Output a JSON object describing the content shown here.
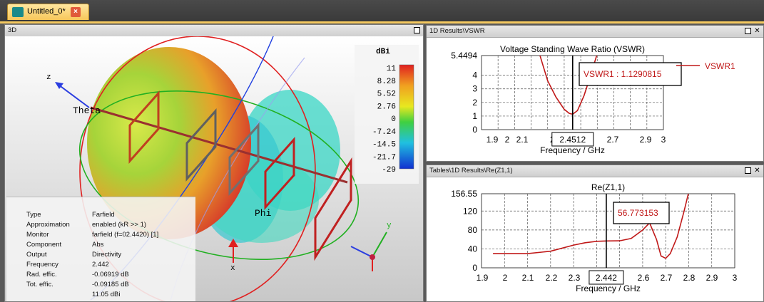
{
  "document_tab": {
    "label": "Untitled_0*",
    "close": "×"
  },
  "panel_3d": {
    "title": "3D",
    "axis_z": "z",
    "axis_theta": "Theta",
    "axis_phi": "Phi",
    "axis_x": "x",
    "axis_y": "y",
    "colorbar": {
      "unit": "dBi",
      "ticks": [
        "11",
        "8.28",
        "5.52",
        "2.76",
        "0",
        "-7.24",
        "-14.5",
        "-21.7",
        "-29"
      ]
    },
    "info": [
      {
        "key": "Type",
        "value": "Farfield"
      },
      {
        "key": "Approximation",
        "value": "enabled (kR >> 1)"
      },
      {
        "key": "Monitor",
        "value": "farfield (f=02.4420) [1]"
      },
      {
        "key": "Component",
        "value": "Abs"
      },
      {
        "key": "Output",
        "value": "Directivity"
      },
      {
        "key": "Frequency",
        "value": "2.442"
      },
      {
        "key": "Rad. effic.",
        "value": "-0.06919 dB"
      },
      {
        "key": "Tot. effic.",
        "value": "-0.09185 dB"
      },
      {
        "key": "",
        "value": "11.05 dBi"
      }
    ]
  },
  "panel_vswr": {
    "title": "1D Results\\VSWR",
    "chart_data": {
      "type": "line",
      "title": "Voltage Standing Wave Ratio (VSWR)",
      "xlabel": "Frequency / GHz",
      "ylabel": "",
      "xlim": [
        1.9,
        3
      ],
      "ylim": [
        0,
        5.4494
      ],
      "x_ticks": [
        "1.9",
        "2",
        "2.1",
        "2.",
        "2.7",
        "2.9",
        "3"
      ],
      "y_ticks": [
        "5.4494",
        "4",
        "3",
        "2",
        "1",
        "0"
      ],
      "marker_x": "2.4512",
      "marker_label": "VSWR1 : 1.1290815",
      "series": [
        {
          "name": "VSWR1",
          "x": [
            2.25,
            2.3,
            2.35,
            2.4,
            2.43,
            2.4512,
            2.48,
            2.52,
            2.56,
            2.6
          ],
          "y": [
            5.6,
            3.6,
            2.4,
            1.5,
            1.2,
            1.13,
            1.4,
            2.5,
            4.0,
            5.6
          ]
        }
      ]
    }
  },
  "panel_re": {
    "title": "Tables\\1D Results\\Re(Z1,1)",
    "chart_data": {
      "type": "line",
      "title": "Re(Z1,1)",
      "xlabel": "Frequency / GHz",
      "ylabel": "",
      "xlim": [
        1.9,
        3
      ],
      "ylim": [
        0,
        156.55
      ],
      "x_ticks": [
        "1.9",
        "2",
        "2.1",
        "2.2",
        "2.3",
        "2.",
        "5",
        "2.6",
        "2.7",
        "2.8",
        "2.9",
        "3"
      ],
      "y_ticks": [
        "156.55",
        "120",
        "80",
        "40",
        "0"
      ],
      "marker_x": "2.442",
      "marker_label": "56.773153",
      "series": [
        {
          "name": "Re(Z1,1)",
          "x": [
            1.95,
            2.0,
            2.1,
            2.2,
            2.3,
            2.35,
            2.4,
            2.442,
            2.5,
            2.55,
            2.6,
            2.63,
            2.66,
            2.68,
            2.7,
            2.72,
            2.75,
            2.78,
            2.8
          ],
          "y": [
            30,
            30,
            30,
            35,
            48,
            53,
            56,
            56.77,
            57,
            62,
            80,
            95,
            60,
            25,
            20,
            30,
            65,
            120,
            160
          ]
        }
      ]
    }
  }
}
